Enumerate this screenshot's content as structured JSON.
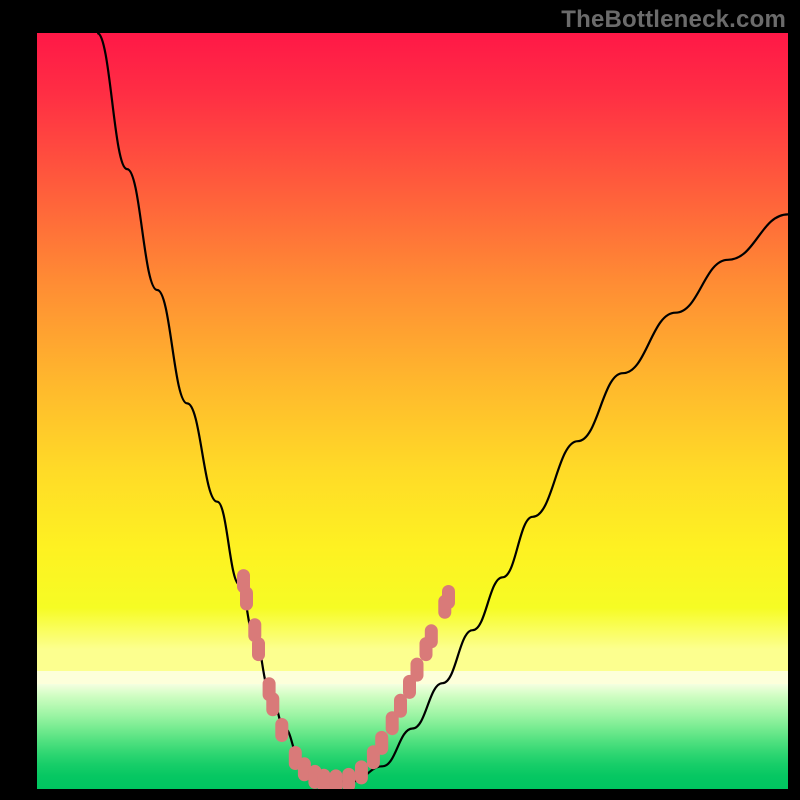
{
  "watermark": "TheBottleneck.com",
  "colors": {
    "background": "#000000",
    "curve": "#000000",
    "marker": "#D97A79"
  },
  "chart_data": {
    "type": "line",
    "title": "",
    "xlabel": "",
    "ylabel": "",
    "xlim": [
      0,
      100
    ],
    "ylim": [
      0,
      100
    ],
    "grid": false,
    "legend": false,
    "note": "Axes are unlabeled; values below are estimated from pixel positions on a 0–100 normalized scale.",
    "series": [
      {
        "name": "bottleneck-curve",
        "x": [
          8,
          12,
          16,
          20,
          24,
          27,
          29,
          31,
          33,
          35,
          37,
          39,
          42,
          46,
          50,
          54,
          58,
          62,
          66,
          72,
          78,
          85,
          92,
          100
        ],
        "y": [
          100,
          82,
          66,
          51,
          38,
          27,
          20,
          13,
          8,
          4,
          2,
          1,
          1,
          3,
          8,
          14,
          21,
          28,
          36,
          46,
          55,
          63,
          70,
          76
        ]
      }
    ],
    "annotations": [
      {
        "name": "marker-cluster",
        "description": "Salmon rounded markers along the lower part of the curve",
        "points_xy": [
          [
            27.5,
            27.5
          ],
          [
            27.9,
            25.2
          ],
          [
            29.0,
            21.0
          ],
          [
            29.5,
            18.5
          ],
          [
            30.9,
            13.2
          ],
          [
            31.4,
            11.2
          ],
          [
            32.6,
            7.8
          ],
          [
            34.4,
            4.1
          ],
          [
            35.6,
            2.6
          ],
          [
            37.0,
            1.6
          ],
          [
            38.2,
            1.1
          ],
          [
            39.8,
            1.0
          ],
          [
            41.5,
            1.2
          ],
          [
            43.2,
            2.2
          ],
          [
            44.8,
            4.2
          ],
          [
            45.9,
            6.1
          ],
          [
            47.3,
            8.7
          ],
          [
            48.4,
            11.0
          ],
          [
            49.6,
            13.5
          ],
          [
            50.6,
            15.8
          ],
          [
            51.8,
            18.5
          ],
          [
            52.5,
            20.2
          ],
          [
            54.3,
            24.1
          ],
          [
            54.8,
            25.4
          ]
        ]
      }
    ],
    "gradient_bands": [
      {
        "y": 100,
        "color": "#FF1847"
      },
      {
        "y": 60,
        "color": "#FFB72D"
      },
      {
        "y": 25,
        "color": "#F6FC24"
      },
      {
        "y": 16,
        "color": "#FCFF8F"
      },
      {
        "y": 14,
        "color": "#FDFFDA"
      },
      {
        "y": 0,
        "color": "#00C560"
      }
    ]
  }
}
